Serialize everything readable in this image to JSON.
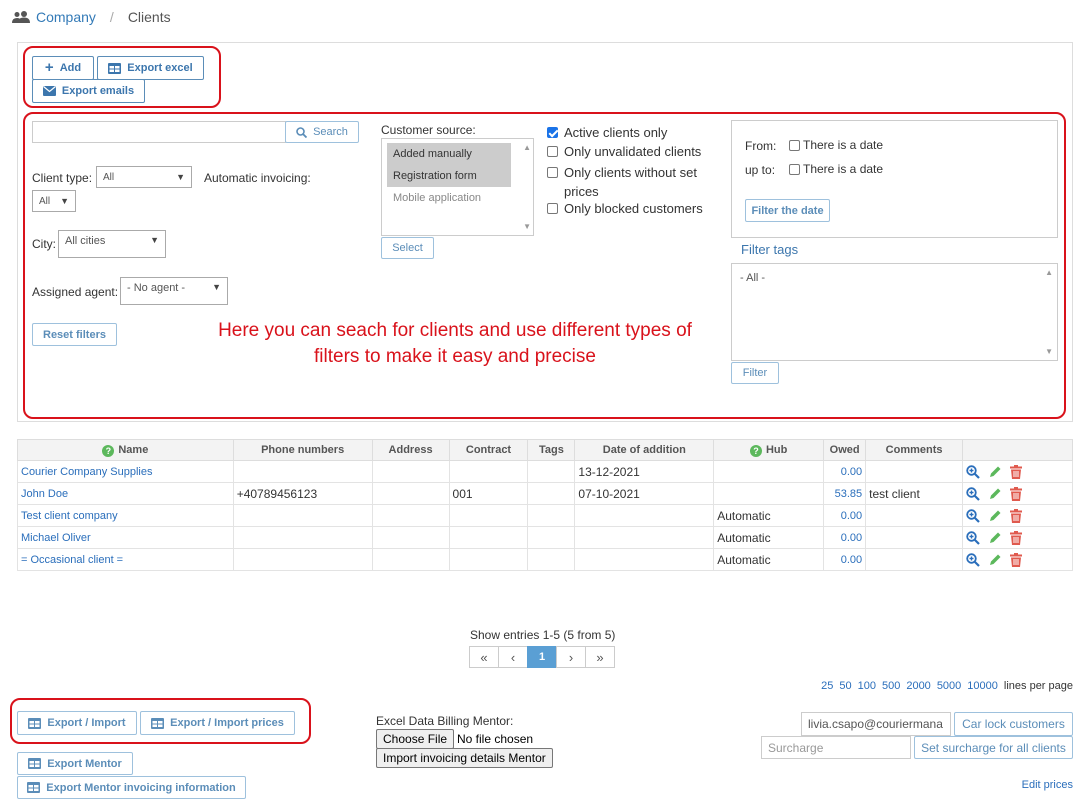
{
  "breadcrumb": {
    "parent": "Company",
    "current": "Clients"
  },
  "toolbar": {
    "add": "Add",
    "export_excel": "Export excel",
    "export_emails": "Export emails"
  },
  "filters": {
    "search_placeholder": "",
    "search_button": "Search",
    "client_type_label": "Client type:",
    "client_type_value": "All",
    "auto_invoicing_label": "Automatic invoicing:",
    "auto_invoicing_value": "All",
    "city_label": "City:",
    "city_value": "All cities",
    "agent_label": "Assigned agent:",
    "agent_value": "- No agent -",
    "reset": "Reset filters",
    "source_label": "Customer source:",
    "source_options": [
      {
        "label": "Added manually",
        "selected": true
      },
      {
        "label": "Registration form",
        "selected": true
      },
      {
        "label": "Mobile application",
        "selected": false
      }
    ],
    "select_button": "Select",
    "checkboxes": [
      {
        "label": "Active clients only",
        "checked": true
      },
      {
        "label": "Only unvalidated clients",
        "checked": false
      },
      {
        "label": "Only clients without set prices",
        "checked": false
      },
      {
        "label": "Only blocked customers",
        "checked": false
      }
    ],
    "from_label": "From:",
    "upto_label": "up to:",
    "date_check": "There is a date",
    "filter_date": "Filter the date",
    "filter_tags_label": "Filter tags",
    "tags_value": "- All -",
    "filter_button": "Filter"
  },
  "annotation": "Here you can seach for clients and use different types of filters to make it easy and precise",
  "table": {
    "headers": [
      "Name",
      "Phone numbers",
      "Address",
      "Contract",
      "Tags",
      "Date of addition",
      "Hub",
      "Owed",
      "Comments",
      ""
    ],
    "rows": [
      {
        "name": "Courier Company Supplies",
        "phone": "",
        "address": "",
        "contract": "",
        "tags": "",
        "date": "13-12-2021",
        "hub": "",
        "owed": "0.00",
        "comments": ""
      },
      {
        "name": "John Doe",
        "phone": "+40789456123",
        "address": "",
        "contract": "001",
        "tags": "",
        "date": "07-10-2021",
        "hub": "",
        "owed": "53.85",
        "comments": "test client"
      },
      {
        "name": "Test client company",
        "phone": "",
        "address": "",
        "contract": "",
        "tags": "",
        "date": "",
        "hub": "Automatic",
        "owed": "0.00",
        "comments": ""
      },
      {
        "name": "Michael Oliver",
        "phone": "",
        "address": "",
        "contract": "",
        "tags": "",
        "date": "",
        "hub": "Automatic",
        "owed": "0.00",
        "comments": ""
      },
      {
        "name": "= Occasional client =",
        "phone": "",
        "address": "",
        "contract": "",
        "tags": "",
        "date": "",
        "hub": "Automatic",
        "owed": "0.00",
        "comments": ""
      }
    ]
  },
  "pagination": {
    "summary": "Show entries 1-5 (5 from 5)",
    "first": "«",
    "prev": "‹",
    "page": "1",
    "next": "›",
    "last": "»"
  },
  "per_page": {
    "options": [
      "25",
      "50",
      "100",
      "500",
      "2000",
      "5000",
      "10000"
    ],
    "suffix": "lines per page"
  },
  "bottom": {
    "export_import": "Export / Import",
    "export_import_prices": "Export / Import prices",
    "export_mentor": "Export Mentor",
    "export_mentor_invoicing": "Export Mentor invoicing information",
    "excel_label": "Excel Data Billing Mentor:",
    "choose_file": "Choose File",
    "no_file": "No file chosen",
    "import_mentor": "Import invoicing details Mentor",
    "email_value": "livia.csapo@couriermana",
    "car_lock": "Car lock customers",
    "surcharge_placeholder": "Surcharge",
    "set_surcharge": "Set surcharge for all clients",
    "edit_prices": "Edit prices"
  },
  "colors": {
    "accent": "#337ab7",
    "annotation_red": "#d9121b",
    "active_page": "#5a9fd4",
    "green": "#5cb85c",
    "delete": "#e05a4e"
  }
}
